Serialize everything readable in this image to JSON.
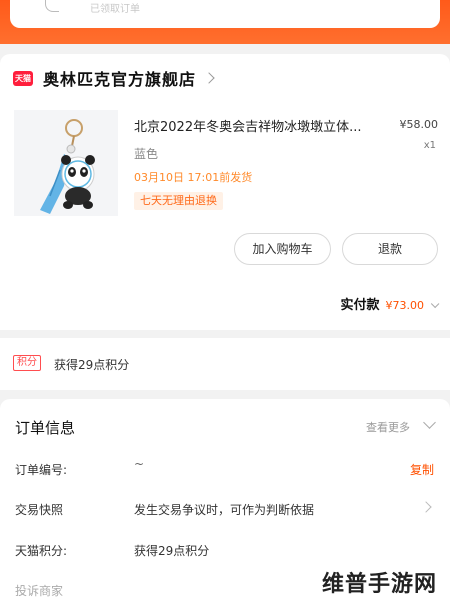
{
  "header": {
    "faint_text": "已领取订单"
  },
  "shop": {
    "badge": "天猫",
    "name": "奥林匹克官方旗舰店"
  },
  "product": {
    "title": "北京2022年冬奥会吉祥物冰墩墩立体...",
    "price": "¥58.00",
    "quantity": "x1",
    "variant": "蓝色",
    "shipping": "03月10日 17:01前发货",
    "tag": "七天无理由退换",
    "add_to_cart": "加入购物车",
    "refund": "退款",
    "paid_label": "实付款",
    "paid_amount": "¥73.00"
  },
  "points": {
    "badge": "积分",
    "text": "获得29点积分"
  },
  "order_info": {
    "title": "订单信息",
    "view_more": "查看更多",
    "rows": [
      {
        "label": "订单编号:",
        "value": "~"
      },
      {
        "label": "交易快照",
        "value": "发生交易争议时，可作为判断依据"
      },
      {
        "label": "天猫积分:",
        "value": "获得29点积分"
      },
      {
        "label": "投诉商家",
        "value": ""
      }
    ],
    "copy": "复制"
  },
  "watermark": "维普手游网",
  "colors": {
    "accent": "#ff5000",
    "header_orange": "#ff6f2e",
    "tmall_red": "#ff1e3c"
  }
}
